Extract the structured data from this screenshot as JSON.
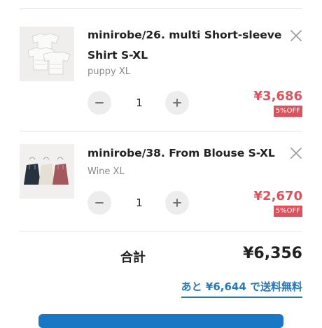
{
  "cart": {
    "items": [
      {
        "name": "minirobe/26. multi Short-sleeve Shirt S-XL",
        "variant": "puppy XL",
        "quantity": "1",
        "price": "¥3,686",
        "discount": "5%OFF",
        "decrement_icon": "minus-icon",
        "increment_icon": "plus-icon",
        "remove_icon": "close-icon"
      },
      {
        "name": "minirobe/38. From Blouse S-XL",
        "variant": "Wine XL",
        "quantity": "1",
        "price": "¥2,670",
        "discount": "5%OFF",
        "decrement_icon": "minus-icon",
        "increment_icon": "plus-icon",
        "remove_icon": "close-icon"
      }
    ]
  },
  "summary": {
    "total_label": "合計",
    "total_value": "¥6,356",
    "free_shipping_text": "あと ¥6,644 で送料無料"
  },
  "colors": {
    "price": "#e0505a",
    "link": "#2c78b5",
    "checkout_button": "#1978c6"
  }
}
